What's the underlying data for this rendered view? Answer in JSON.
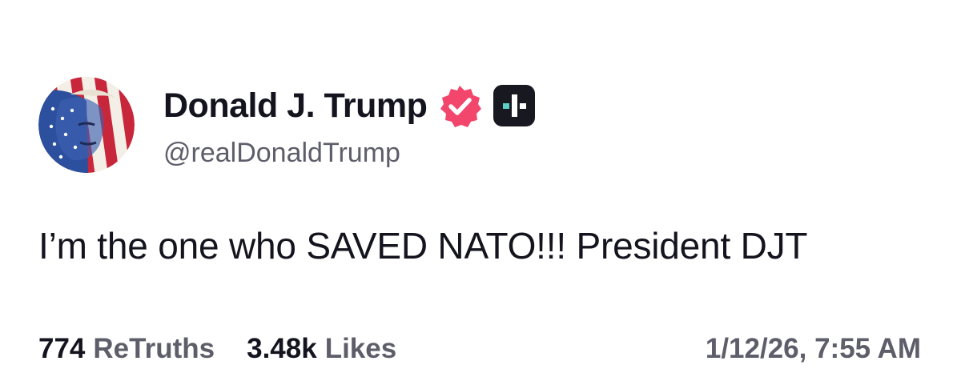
{
  "post": {
    "author": {
      "display_name": "Donald J. Trump",
      "handle": "@realDonaldTrump",
      "avatar_icon": "flag-portrait-avatar",
      "verified_icon": "verified-badge-icon",
      "plus_icon": "truth-plus-icon"
    },
    "text": "I’m the one who SAVED NATO!!! President DJT",
    "stats": {
      "retruths_count": "774",
      "retruths_label": "ReTruths",
      "likes_count": "3.48k",
      "likes_label": "Likes"
    },
    "timestamp": "1/12/26, 7:55 AM"
  },
  "colors": {
    "text_primary": "#14141e",
    "text_secondary": "#5e5e6a",
    "verified_pink": "#f2466c",
    "plus_dark": "#181820",
    "plus_teal": "#5bd0c8",
    "flag_red": "#c8263a",
    "flag_blue": "#2c4f9e"
  }
}
